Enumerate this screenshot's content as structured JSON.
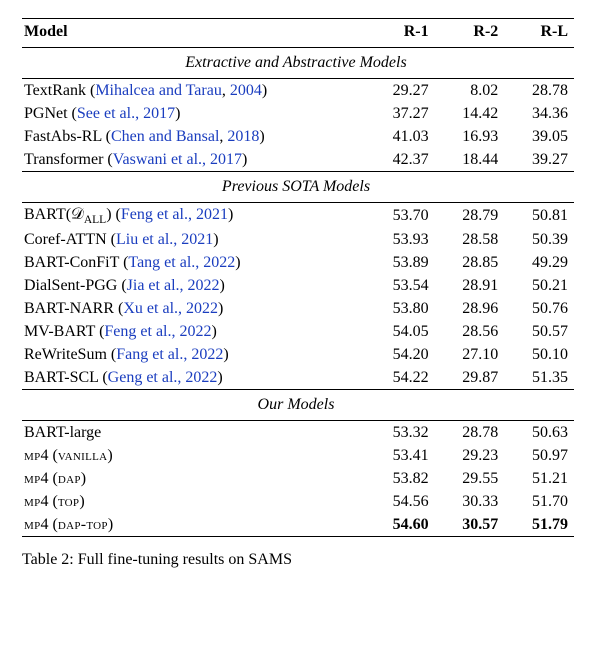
{
  "header": {
    "model": "Model",
    "r1": "R-1",
    "r2": "R-2",
    "rl": "R-L"
  },
  "sections": [
    {
      "title": "Extractive and Abstractive Models",
      "rows": [
        {
          "name": "TextRank",
          "cite_linked": "Mihalcea and Tarau",
          "cite_year": "2004",
          "r1": "29.27",
          "r2": "8.02",
          "rl": "28.78"
        },
        {
          "name": "PGNet",
          "cite_plain": "See et al., 2017",
          "r1": "37.27",
          "r2": "14.42",
          "rl": "34.36"
        },
        {
          "name": "FastAbs-RL",
          "cite_linked": "Chen and Bansal",
          "cite_year": "2018",
          "r1": "41.03",
          "r2": "16.93",
          "rl": "39.05"
        },
        {
          "name": "Transformer",
          "cite_plain": "Vaswani et al., 2017",
          "r1": "42.37",
          "r2": "18.44",
          "rl": "39.27"
        }
      ]
    },
    {
      "title": "Previous SOTA Models",
      "rows": [
        {
          "name_html": "BART(𝒟<span class=\"subscript\">ALL</span>)",
          "cite_plain": "Feng et al., 2021",
          "r1": "53.70",
          "r2": "28.79",
          "rl": "50.81"
        },
        {
          "name": "Coref-ATTN",
          "cite_plain": "Liu et al., 2021",
          "r1": "53.93",
          "r2": "28.58",
          "rl": "50.39"
        },
        {
          "name": "BART-ConFiT",
          "cite_plain": "Tang et al., 2022",
          "r1": "53.89",
          "r2": "28.85",
          "rl": "49.29"
        },
        {
          "name": "DialSent-PGG",
          "cite_plain": "Jia et al., 2022",
          "r1": "53.54",
          "r2": "28.91",
          "rl": "50.21"
        },
        {
          "name": "BART-NARR",
          "cite_plain": "Xu et al., 2022",
          "r1": "53.80",
          "r2": "28.96",
          "rl": "50.76"
        },
        {
          "name": "MV-BART",
          "cite_plain": "Feng et al., 2022",
          "r1": "54.05",
          "r2": "28.56",
          "rl": "50.57"
        },
        {
          "name": "ReWriteSum",
          "cite_plain": "Fang et al., 2022",
          "r1": "54.20",
          "r2": "27.10",
          "rl": "50.10"
        },
        {
          "name": "BART-SCL",
          "cite_plain": "Geng et al., 2022",
          "r1": "54.22",
          "r2": "29.87",
          "rl": "51.35"
        }
      ]
    },
    {
      "title": "Our Models",
      "rows": [
        {
          "name": "BART-large",
          "r1": "53.32",
          "r2": "28.78",
          "rl": "50.63"
        },
        {
          "name_html": "<span class=\"smallcaps\">mp</span>4 (<span class=\"smallcaps\">vanilla</span>)",
          "r1": "53.41",
          "r2": "29.23",
          "rl": "50.97"
        },
        {
          "name_html": "<span class=\"smallcaps\">mp</span>4 (<span class=\"smallcaps\">dap</span>)",
          "r1": "53.82",
          "r2": "29.55",
          "rl": "51.21"
        },
        {
          "name_html": "<span class=\"smallcaps\">mp</span>4 (<span class=\"smallcaps\">top</span>)",
          "r1": "54.56",
          "r2": "30.33",
          "rl": "51.70"
        },
        {
          "name_html": "<span class=\"smallcaps\">mp</span>4 (<span class=\"smallcaps\">dap-top</span>)",
          "r1": "54.60",
          "r2": "30.57",
          "rl": "51.79",
          "bold": true
        }
      ]
    }
  ],
  "caption_prefix": "Table 2:",
  "caption_text": "Full fine-tuning results on SAMS"
}
